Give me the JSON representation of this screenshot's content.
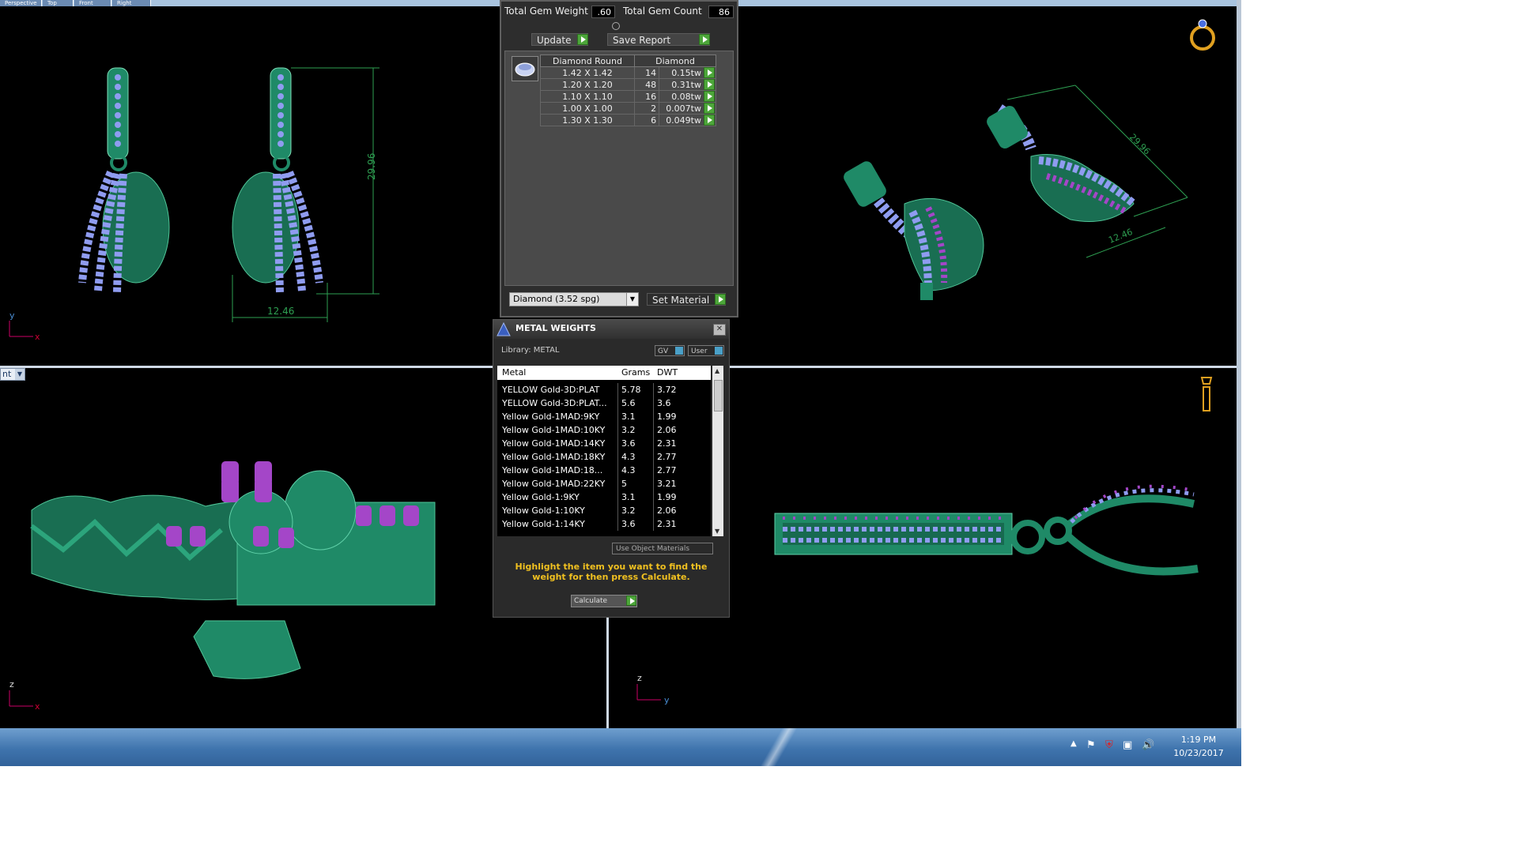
{
  "top_tabs": [
    "Perspective",
    "Top",
    "Front",
    "Right"
  ],
  "viewport_front": {
    "dimension_height": "29.96",
    "dimension_width": "12.46",
    "axes": [
      "y",
      "x"
    ]
  },
  "viewport_persp": {
    "dimension_length": "29.96",
    "dimension_width": "12.46"
  },
  "viewport_bottom_left": {
    "dropdown_label": "nt",
    "axes": [
      "z",
      "x"
    ]
  },
  "viewport_bottom_right": {
    "axes": [
      "z",
      "y"
    ]
  },
  "gem_panel": {
    "total_weight_label": "Total Gem Weight",
    "total_weight_value": ".60",
    "total_count_label": "Total Gem Count",
    "total_count_value": "86",
    "update_label": "Update",
    "save_report_label": "Save Report",
    "col_shape": "Diamond Round",
    "col_material": "Diamond",
    "rows": [
      {
        "size": "1.42 X 1.42",
        "count": "14",
        "weight": "0.15tw"
      },
      {
        "size": "1.20 X 1.20",
        "count": "48",
        "weight": "0.31tw"
      },
      {
        "size": "1.10 X 1.10",
        "count": "16",
        "weight": "0.08tw"
      },
      {
        "size": "1.00 X 1.00",
        "count": "2",
        "weight": "0.007tw"
      },
      {
        "size": "1.30 X 1.30",
        "count": "6",
        "weight": "0.049tw"
      }
    ],
    "material_select": "Diamond     (3.52 spg)",
    "set_material_label": "Set Material"
  },
  "metal_weights": {
    "title": "METAL WEIGHTS",
    "library_label": "Library: METAL",
    "gv_label": "GV",
    "user_label": "User",
    "col_metal": "Metal",
    "col_grams": "Grams",
    "col_dwt": "DWT",
    "rows": [
      {
        "metal": "YELLOW Gold-3D:PLAT",
        "grams": "5.78",
        "dwt": "3.72"
      },
      {
        "metal": "YELLOW Gold-3D:PLAT...",
        "grams": "5.6",
        "dwt": "3.6"
      },
      {
        "metal": "Yellow Gold-1MAD:9KY",
        "grams": "3.1",
        "dwt": "1.99"
      },
      {
        "metal": "Yellow Gold-1MAD:10KY",
        "grams": "3.2",
        "dwt": "2.06"
      },
      {
        "metal": "Yellow Gold-1MAD:14KY",
        "grams": "3.6",
        "dwt": "2.31"
      },
      {
        "metal": "Yellow Gold-1MAD:18KY",
        "grams": "4.3",
        "dwt": "2.77"
      },
      {
        "metal": "Yellow Gold-1MAD:18...",
        "grams": "4.3",
        "dwt": "2.77"
      },
      {
        "metal": "Yellow Gold-1MAD:22KY",
        "grams": "5",
        "dwt": "3.21"
      },
      {
        "metal": "Yellow Gold-1:9KY",
        "grams": "3.1",
        "dwt": "1.99"
      },
      {
        "metal": "Yellow Gold-1:10KY",
        "grams": "3.2",
        "dwt": "2.06"
      },
      {
        "metal": "Yellow Gold-1:14KY",
        "grams": "3.6",
        "dwt": "2.31"
      }
    ],
    "use_object_materials_label": "Use Object Materials",
    "hint": "Highlight the item you want to find the weight for then press Calculate.",
    "calculate_label": "Calculate"
  },
  "taskbar": {
    "time": "1:19 PM",
    "date": "10/23/2017"
  },
  "colors": {
    "model_green": "#1f8a67",
    "gem_blue": "#8f9cf0",
    "gem_purple": "#a446c8",
    "dim_green": "#2ea052",
    "accent_go": "#4da63a"
  }
}
